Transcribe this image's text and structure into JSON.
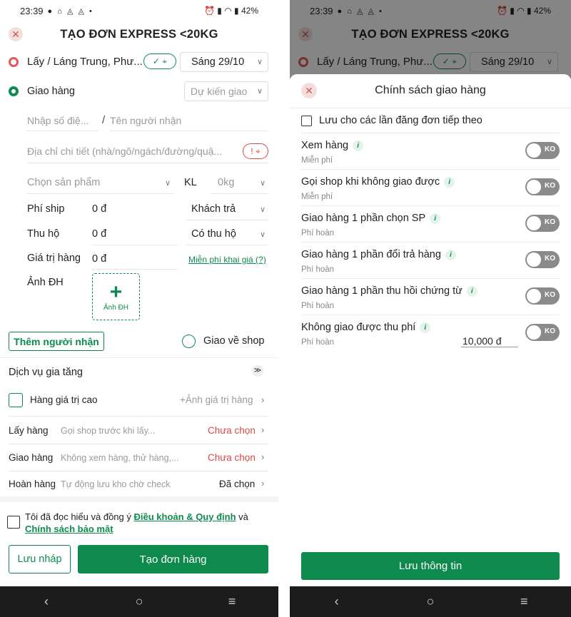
{
  "status": {
    "time": "23:39",
    "battery": "42%"
  },
  "left": {
    "title": "TẠO ĐƠN EXPRESS <20KG",
    "pickup": {
      "label": "Lấy / Láng Trung, Phư...",
      "date": "Sáng 29/10"
    },
    "delivery": {
      "label": "Giao hàng",
      "expected": "Dự kiến giao"
    },
    "phone_placeholder": "Nhập số điệ...",
    "name_placeholder": "Tên người nhận",
    "address_placeholder": "Địa chỉ chi tiết (nhà/ngõ/ngách/đường/quậ...",
    "product_placeholder": "Chọn sản phẩm",
    "weight_label": "KL",
    "weight_value": "0kg",
    "ship_fee": {
      "label": "Phí ship",
      "value": "0 đ",
      "payer": "Khách trả"
    },
    "cod": {
      "label": "Thu hộ",
      "value": "0 đ",
      "option": "Có thu hộ"
    },
    "goods_value": {
      "label": "Giá trị hàng",
      "value": "0 đ",
      "link": "Miễn phí khai giá (?)"
    },
    "photo": {
      "label": "Ảnh ĐH",
      "button": "Ảnh ĐH"
    },
    "add_recipient": "Thêm người nhận",
    "return_to_shop": "Giao về shop",
    "value_added": "Dịch vụ gia tăng",
    "high_value": {
      "label": "Hàng giá trị cao",
      "action": "+Ảnh giá trị hàng"
    },
    "services": [
      {
        "name": "Lấy hàng",
        "desc": "Gọi shop trước khi lấy...",
        "status": "Chưa chọn",
        "state": "unset"
      },
      {
        "name": "Giao hàng",
        "desc": "Không xem hàng, thử hàng,...",
        "status": "Chưa chọn",
        "state": "unset"
      },
      {
        "name": "Hoàn hàng",
        "desc": "Tự động lưu kho chờ check",
        "status": "Đã chọn",
        "state": "set"
      }
    ],
    "terms": {
      "prefix": "Tôi đã đọc hiểu và đồng ý",
      "link1": "Điều khoản & Quy định",
      "and": "và",
      "link2": "Chính sách bảo mật"
    },
    "save_draft": "Lưu nháp",
    "create_order": "Tạo đơn hàng"
  },
  "right": {
    "sheet_title": "Chính sách giao hàng",
    "remember": "Lưu cho các lần đăng đơn tiếp theo",
    "toggle_off": "KO",
    "policies": [
      {
        "name": "Xem hàng",
        "sub": "Miễn phí",
        "fee": ""
      },
      {
        "name": "Gọi shop khi không giao được",
        "sub": "Miễn phí",
        "fee": ""
      },
      {
        "name": "Giao hàng 1 phần chọn SP",
        "sub": "Phí hoàn",
        "fee": ""
      },
      {
        "name": "Giao hàng 1 phần đổi trả hàng",
        "sub": "Phí hoàn",
        "fee": ""
      },
      {
        "name": "Giao hàng 1 phần thu hồi chứng từ",
        "sub": "Phí hoàn",
        "fee": ""
      },
      {
        "name": "Không giao được thu phí",
        "sub": "Phí hoàn",
        "fee": "10,000 đ"
      }
    ],
    "save_button": "Lưu thông tin"
  },
  "colors": {
    "brand_green": "#0e8a4d",
    "alert_red": "#d94848"
  }
}
